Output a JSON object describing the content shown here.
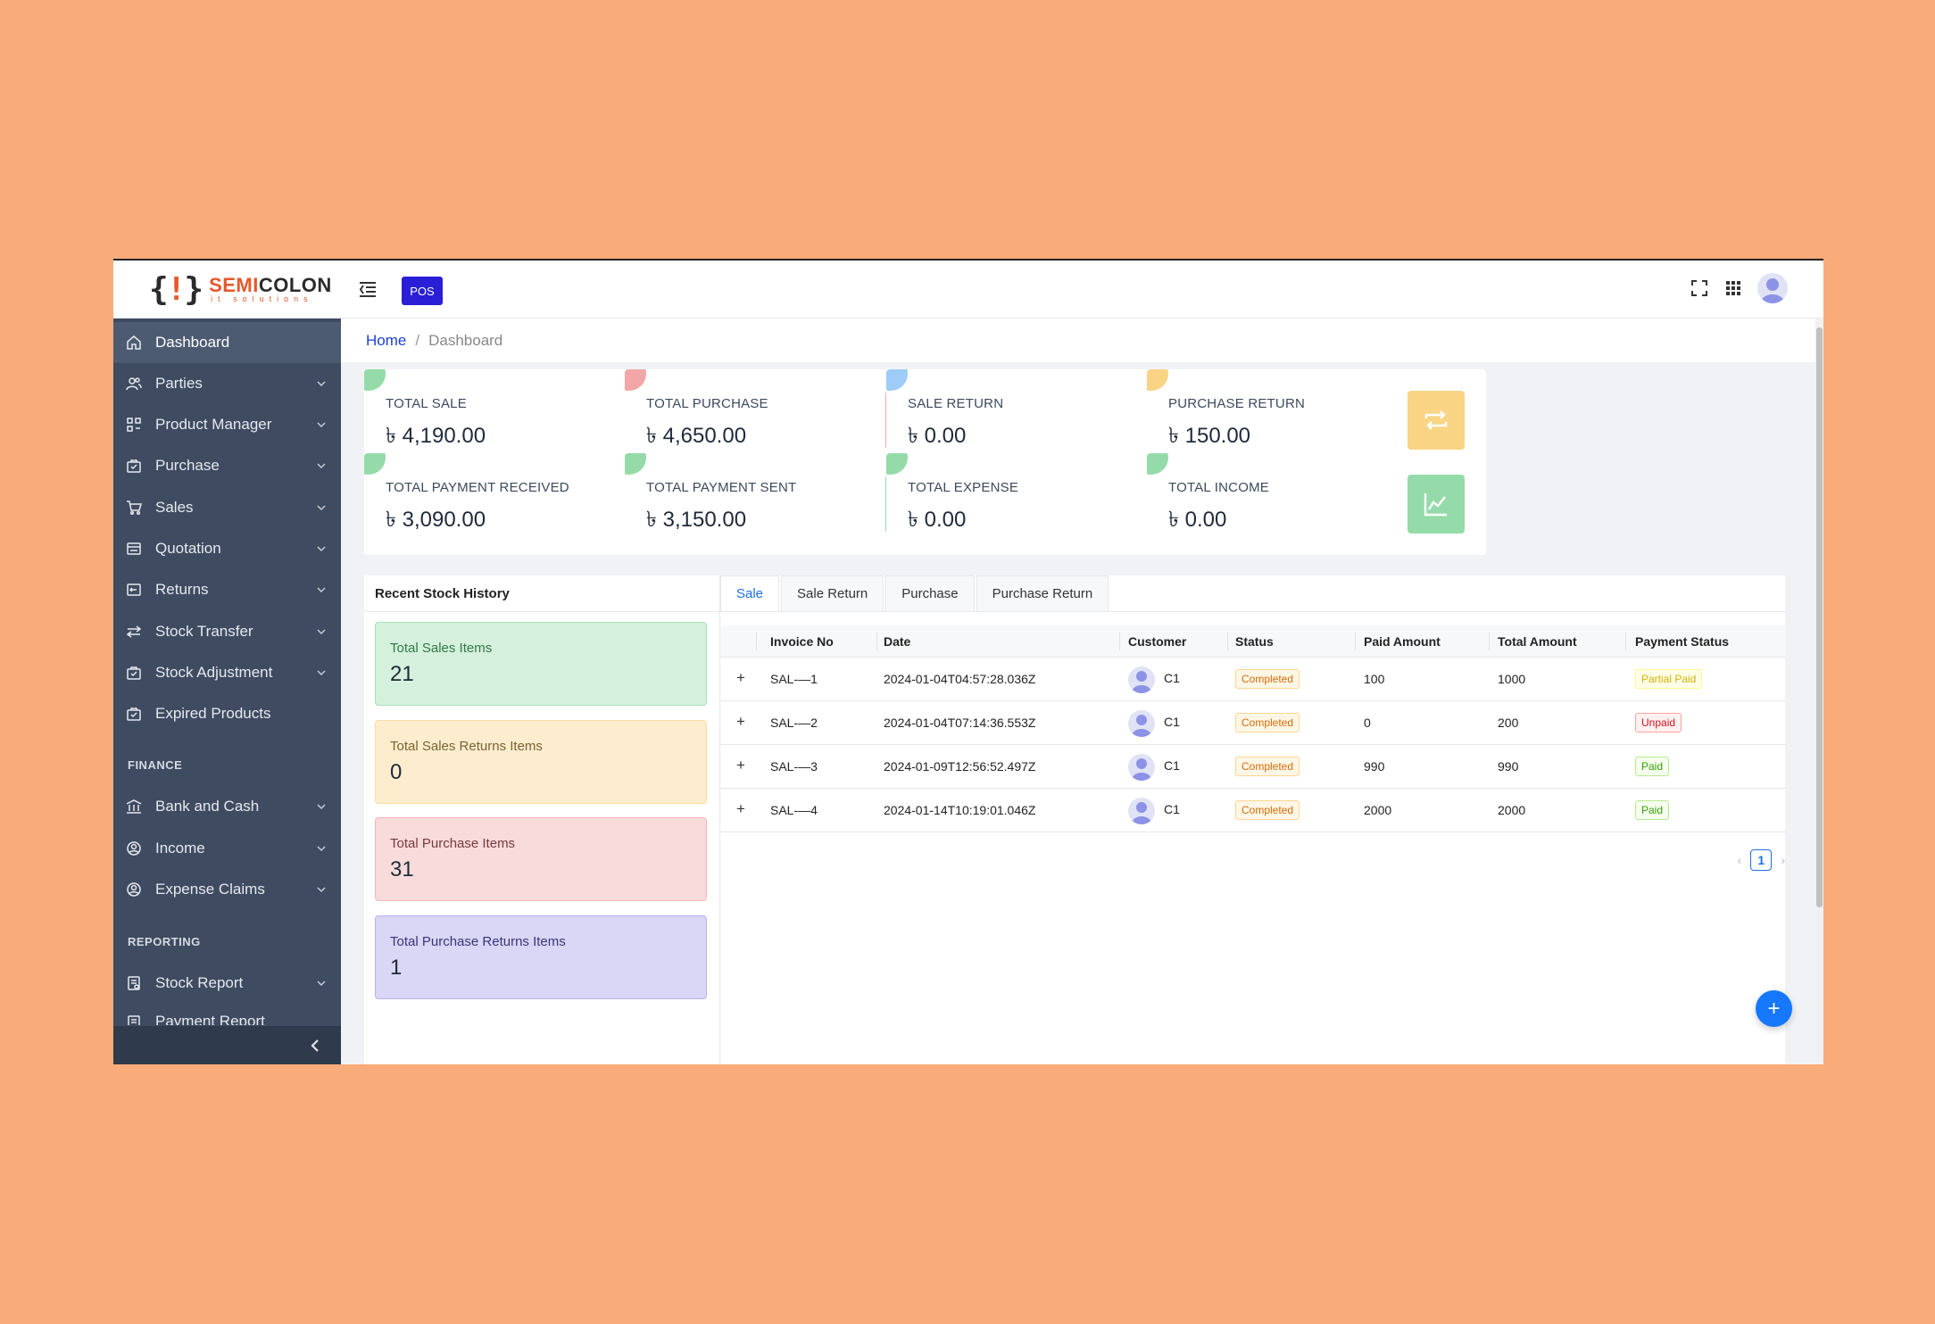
{
  "brand": {
    "name_accent": "SEMI",
    "name_rest": "COLON",
    "tagline": "it solutions"
  },
  "topbar": {
    "pos_label": "POS"
  },
  "sidebar": {
    "items": [
      {
        "label": "Dashboard",
        "icon": "home-icon",
        "active": true
      },
      {
        "label": "Parties",
        "icon": "users-icon"
      },
      {
        "label": "Product Manager",
        "icon": "product-icon"
      },
      {
        "label": "Purchase",
        "icon": "bag-icon"
      },
      {
        "label": "Sales",
        "icon": "cart-icon"
      },
      {
        "label": "Quotation",
        "icon": "calculator-icon"
      },
      {
        "label": "Returns",
        "icon": "return-icon"
      },
      {
        "label": "Stock Transfer",
        "icon": "transfer-icon"
      },
      {
        "label": "Stock Adjustment",
        "icon": "bag-icon"
      },
      {
        "label": "Expired Products",
        "icon": "bag-icon"
      }
    ],
    "finance_title": "FINANCE",
    "finance_items": [
      {
        "label": "Bank and Cash",
        "icon": "bank-icon"
      },
      {
        "label": "Income",
        "icon": "income-icon"
      },
      {
        "label": "Expense Claims",
        "icon": "expense-icon"
      }
    ],
    "reporting_title": "REPORTING",
    "reporting_items": [
      {
        "label": "Stock Report",
        "icon": "report-icon"
      },
      {
        "label": "Payment Report",
        "icon": "report-icon"
      }
    ]
  },
  "breadcrumb": {
    "home": "Home",
    "separator": "/",
    "current": "Dashboard"
  },
  "cards": [
    {
      "label": "TOTAL SALE",
      "value": "৳ 4,190.00",
      "icon": "chart-line-icon",
      "color": "#95dba9",
      "corner": "#95dba9"
    },
    {
      "label": "TOTAL PURCHASE",
      "value": "৳ 4,650.00",
      "icon": "shopping-bag-icon",
      "color": "#f2a6a6",
      "corner": "#f2a6a6"
    },
    {
      "label": "SALE RETURN",
      "value": "৳ 0.00",
      "icon": "return-arrow-icon",
      "color": "#9ecbf7",
      "corner": "#9ecbf7"
    },
    {
      "label": "PURCHASE RETURN",
      "value": "৳ 150.00",
      "icon": "swap-icon",
      "color": "#f9d485",
      "corner": "#f9d485"
    },
    {
      "label": "TOTAL PAYMENT RECEIVED",
      "value": "৳ 3,090.00",
      "icon": "chart-line-icon",
      "color": "#95dba9",
      "corner": "#95dba9"
    },
    {
      "label": "TOTAL PAYMENT SENT",
      "value": "৳ 3,150.00",
      "icon": "chart-line-icon",
      "color": "#95dba9",
      "corner": "#95dba9"
    },
    {
      "label": "TOTAL EXPENSE",
      "value": "৳ 0.00",
      "icon": "chart-line-icon",
      "color": "#95dba9",
      "corner": "#95dba9"
    },
    {
      "label": "TOTAL INCOME",
      "value": "৳ 0.00",
      "icon": "chart-line-icon",
      "color": "#95dba9",
      "corner": "#95dba9"
    }
  ],
  "stock_history": {
    "title": "Recent Stock History",
    "stats": [
      {
        "label": "Total Sales Items",
        "value": "21",
        "bg": "#d5f0dd",
        "border": "#a8e0b8",
        "label_color": "#2f7a43"
      },
      {
        "label": "Total Sales Returns Items",
        "value": "0",
        "bg": "#fdedce",
        "border": "#f9dca1",
        "label_color": "#7a6330"
      },
      {
        "label": "Total Purchase Items",
        "value": "31",
        "bg": "#f9dbdc",
        "border": "#f3b7ba",
        "label_color": "#7a3a3e"
      },
      {
        "label": "Total Purchase Returns Items",
        "value": "1",
        "bg": "#d9d6f6",
        "border": "#b7b1ee",
        "label_color": "#3a357a"
      }
    ]
  },
  "tabs": [
    "Sale",
    "Sale Return",
    "Purchase",
    "Purchase Return"
  ],
  "active_tab": "Sale",
  "table": {
    "columns": [
      "Invoice No",
      "Date",
      "Customer",
      "Status",
      "Paid Amount",
      "Total Amount",
      "Payment Status"
    ],
    "rows": [
      {
        "invoice": "SAL-—1",
        "date": "2024-01-04T04:57:28.036Z",
        "customer": "C1",
        "status": "Completed",
        "paid": "100",
        "total": "1000",
        "payment_status": "Partial Paid",
        "ps_class": "b-partial"
      },
      {
        "invoice": "SAL-—2",
        "date": "2024-01-04T07:14:36.553Z",
        "customer": "C1",
        "status": "Completed",
        "paid": "0",
        "total": "200",
        "payment_status": "Unpaid",
        "ps_class": "b-unpaid"
      },
      {
        "invoice": "SAL-—3",
        "date": "2024-01-09T12:56:52.497Z",
        "customer": "C1",
        "status": "Completed",
        "paid": "990",
        "total": "990",
        "payment_status": "Paid",
        "ps_class": "b-paid"
      },
      {
        "invoice": "SAL-—4",
        "date": "2024-01-14T10:19:01.046Z",
        "customer": "C1",
        "status": "Completed",
        "paid": "2000",
        "total": "2000",
        "payment_status": "Paid",
        "ps_class": "b-paid"
      }
    ],
    "expand_symbol": "+"
  },
  "pagination": {
    "current_page": "1",
    "prev": "‹",
    "next": "›"
  },
  "fab": {
    "label": "+"
  }
}
